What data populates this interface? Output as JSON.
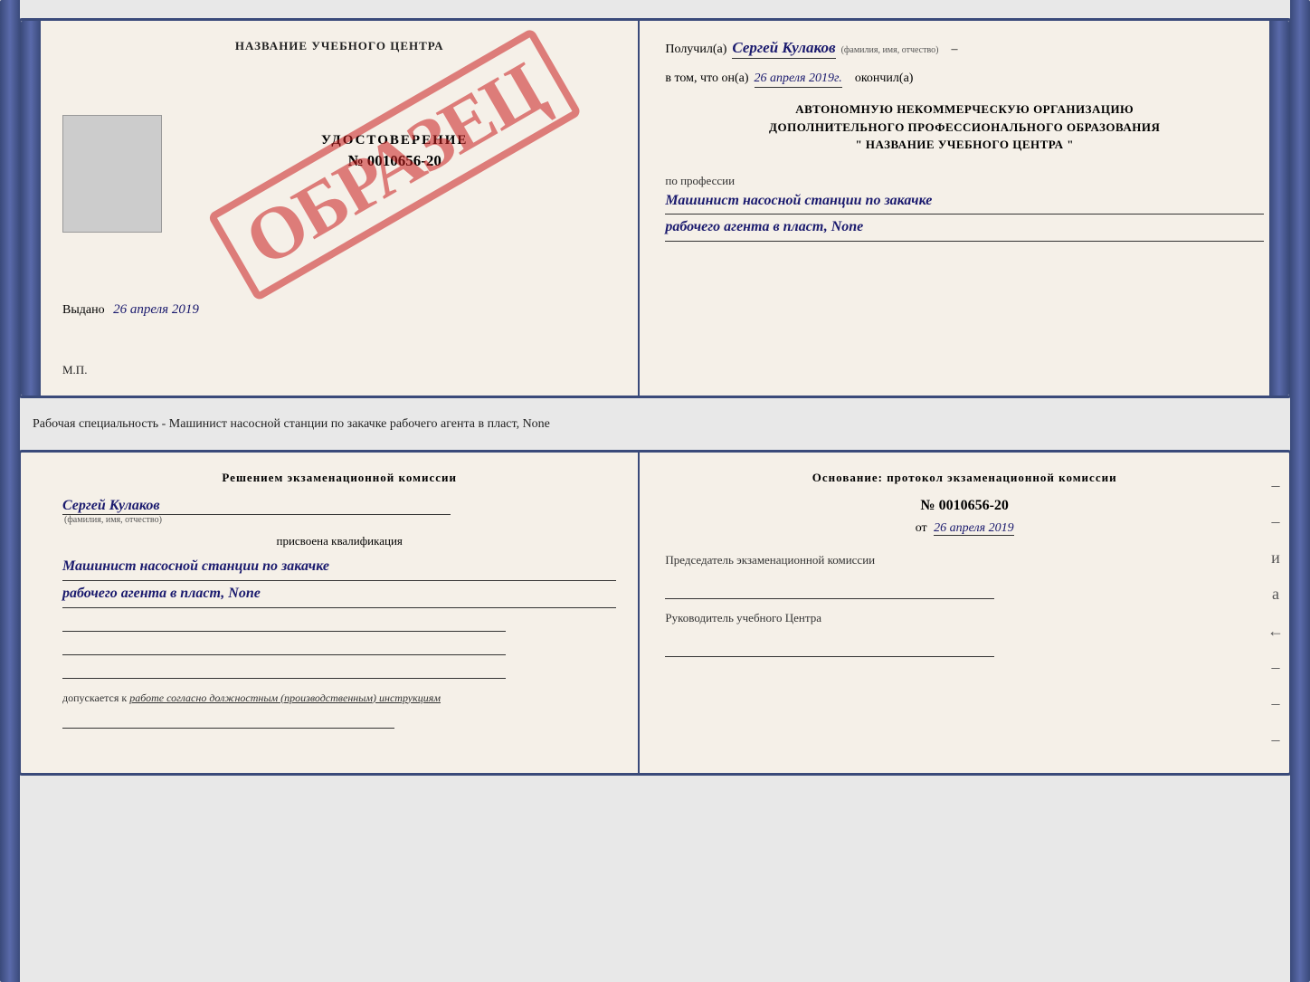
{
  "topDocument": {
    "left": {
      "title": "НАЗВАНИЕ УЧЕБНОГО ЦЕНТРА",
      "stamp": "ОБРАЗЕЦ",
      "certLabel": "УДОСТОВЕРЕНИЕ",
      "certNumber": "№ 0010656-20",
      "issuedLabel": "Выдано",
      "issuedDate": "26 апреля 2019",
      "mpLabel": "М.П."
    },
    "right": {
      "recipientLabel": "Получил(а)",
      "recipientName": "Сергей Кулаков",
      "recipientHint": "(фамилия, имя, отчество)",
      "dash1": "–",
      "dateLabel": "в том, что он(а)",
      "dateValue": "26 апреля 2019г.",
      "finishedLabel": "окончил(а)",
      "orgLine1": "АВТОНОМНУЮ НЕКОММЕРЧЕСКУЮ ОРГАНИЗАЦИЮ",
      "orgLine2": "ДОПОЛНИТЕЛЬНОГО ПРОФЕССИОНАЛЬНОГО ОБРАЗОВАНИЯ",
      "orgLine3": "\"   НАЗВАНИЕ УЧЕБНОГО ЦЕНТРА   \"",
      "professionLabel": "по профессии",
      "professionValue1": "Машинист насосной станции по закачке",
      "professionValue2": "рабочего агента в пласт, None"
    }
  },
  "specialtyText": "Рабочая специальность - Машинист насосной станции по закачке рабочего агента в пласт, None",
  "bottomDocument": {
    "left": {
      "commissionTitle": "Решением экзаменационной комиссии",
      "personName": "Сергей Кулаков",
      "personHint": "(фамилия, имя, отчество)",
      "assignedLabel": "присвоена квалификация",
      "qualification1": "Машинист насосной станции по закачке",
      "qualification2": "рабочего агента в пласт, None",
      "allowedLabel": "допускается к",
      "allowedValue": "работе согласно должностным (производственным) инструкциям"
    },
    "right": {
      "basisTitle": "Основание: протокол экзаменационной комиссии",
      "protocolNumber": "№ 0010656-20",
      "protocolFromLabel": "от",
      "protocolDate": "26 апреля 2019",
      "chairTitle": "Председатель экзаменационной комиссии",
      "headTitle": "Руководитель учебного Центра"
    }
  }
}
